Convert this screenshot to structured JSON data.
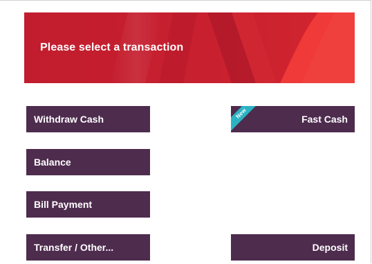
{
  "colors": {
    "banner_red": "#c51f2e",
    "banner_bright_red": "#ef3a39",
    "button_purple": "#4e2c4e",
    "new_badge_teal": "#2bb3c3",
    "text_white": "#ffffff"
  },
  "banner": {
    "title": "Please select a transaction"
  },
  "transactions": {
    "withdraw": "Withdraw Cash",
    "balance": "Balance",
    "bill_payment": "Bill Payment",
    "transfer_other": "Transfer / Other...",
    "fast_cash": "Fast Cash",
    "fast_cash_badge": "New",
    "deposit": "Deposit"
  }
}
